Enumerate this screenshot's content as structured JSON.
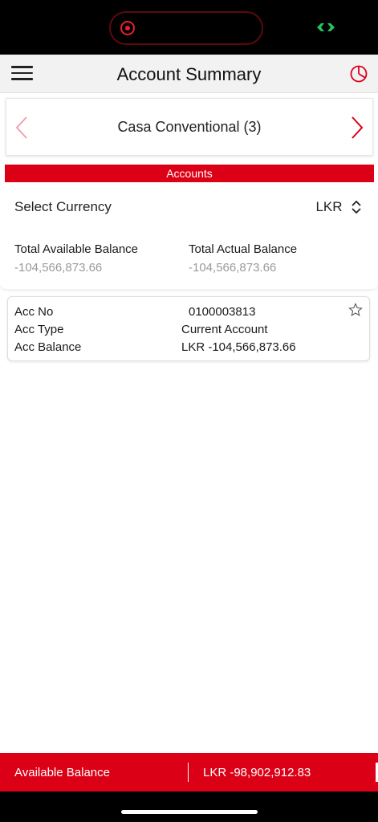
{
  "header": {
    "title": "Account Summary",
    "menu_icon": "hamburger-menu-icon",
    "right_icon": "pie-chart-icon"
  },
  "category": {
    "title": "Casa Conventional (3)"
  },
  "accounts_bar": {
    "label": "Accounts"
  },
  "currency": {
    "label": "Select Currency",
    "value": "LKR"
  },
  "totals": {
    "available_label": "Total Available Balance",
    "available_value": "-104,566,873.66",
    "actual_label": "Total Actual Balance",
    "actual_value": "-104,566,873.66"
  },
  "accounts": [
    {
      "acc_no_label": "Acc No",
      "acc_no": "0100003813",
      "acc_type_label": "Acc Type",
      "acc_type": "Current Account",
      "acc_balance_label": "Acc Balance",
      "acc_balance": "LKR -104,566,873.66"
    }
  ],
  "bottom_bar": {
    "label": "Available Balance",
    "value": "LKR -98,902,912.83"
  },
  "colors": {
    "brand_red": "#dc0016",
    "muted_text": "#9a9a9a"
  }
}
